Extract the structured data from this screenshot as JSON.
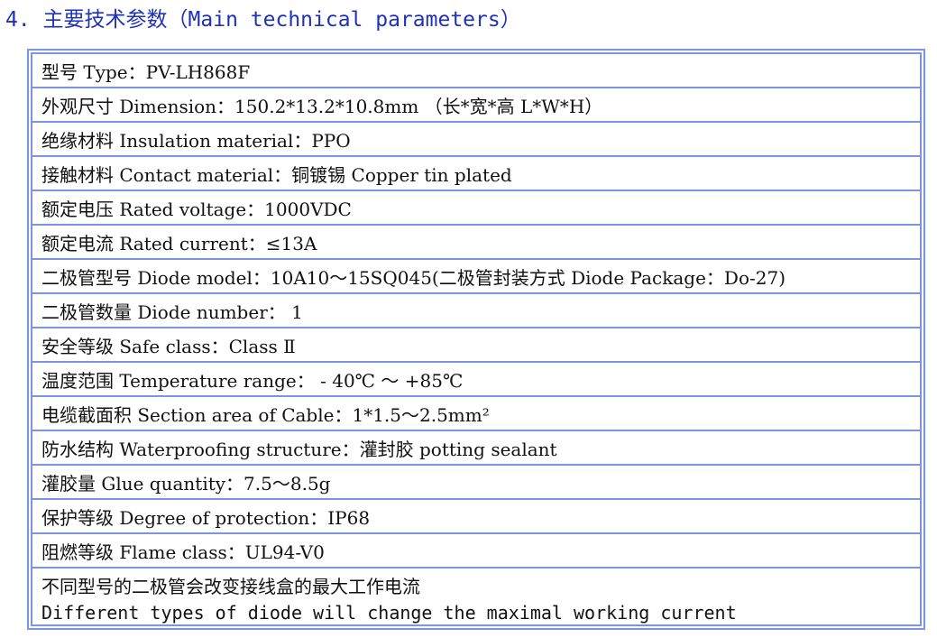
{
  "section": {
    "title": "4. 主要技术参数（Main technical parameters）"
  },
  "rows": [
    "型号 Type：PV-LH868F",
    "外观尺寸 Dimension：150.2*13.2*10.8mm （长*宽*高 L*W*H）",
    "绝缘材料 Insulation material：PPO",
    "接触材料 Contact material：铜镀锡 Copper tin plated",
    "额定电压 Rated voltage：1000VDC",
    "额定电流 Rated current：≤13A",
    "二极管型号 Diode model：10A10～15SQ045(二极管封装方式 Diode Package：Do-27)",
    "二极管数量 Diode number： 1",
    "安全等级 Safe class：Class Ⅱ",
    "温度范围 Temperature range： - 40℃ ～ +85℃",
    "电缆截面积 Section area of Cable：1*1.5～2.5mm²",
    "防水结构 Waterproofing structure：灌封胶 potting sealant",
    "灌胶量 Glue quantity：7.5～8.5g",
    "保护等级 Degree of protection：IP68",
    "阻燃等级 Flame class：UL94-V0"
  ],
  "note": {
    "line_cn": "不同型号的二极管会改变接线盒的最大工作电流",
    "line_en": "Different types of diode will change the maximal working current"
  },
  "colors": {
    "heading": "#1f31b8",
    "border": "#7d93e8",
    "text": "#111111"
  }
}
